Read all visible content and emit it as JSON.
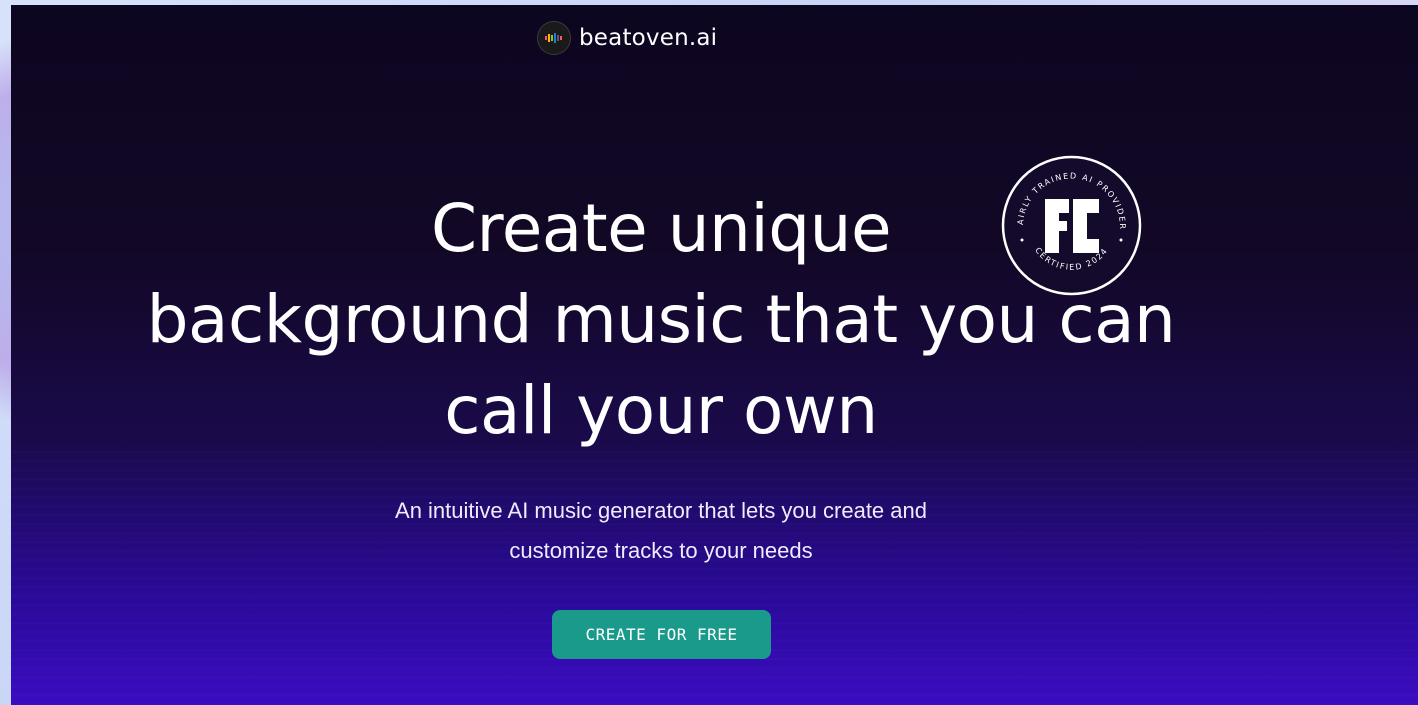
{
  "brand": {
    "name": "beatoven.ai",
    "logo_icon": "equalizer-icon"
  },
  "hero": {
    "headline_line1": "Create unique",
    "headline_line2": "background music that you can",
    "headline_line3": "call your own",
    "subtitle_line1": "An intuitive AI music generator that lets you create and",
    "subtitle_line2": "customize tracks to your needs",
    "cta_label": "CREATE FOR FREE"
  },
  "badge": {
    "top_text": "FAIRLY TRAINED AI PROVIDER",
    "bottom_text": "CERTIFIED 2024",
    "monogram": "FT"
  },
  "colors": {
    "hero_top": "#0d0620",
    "hero_bottom": "#3b0cc0",
    "cta": "#1a9a8a",
    "text": "#ffffff"
  }
}
